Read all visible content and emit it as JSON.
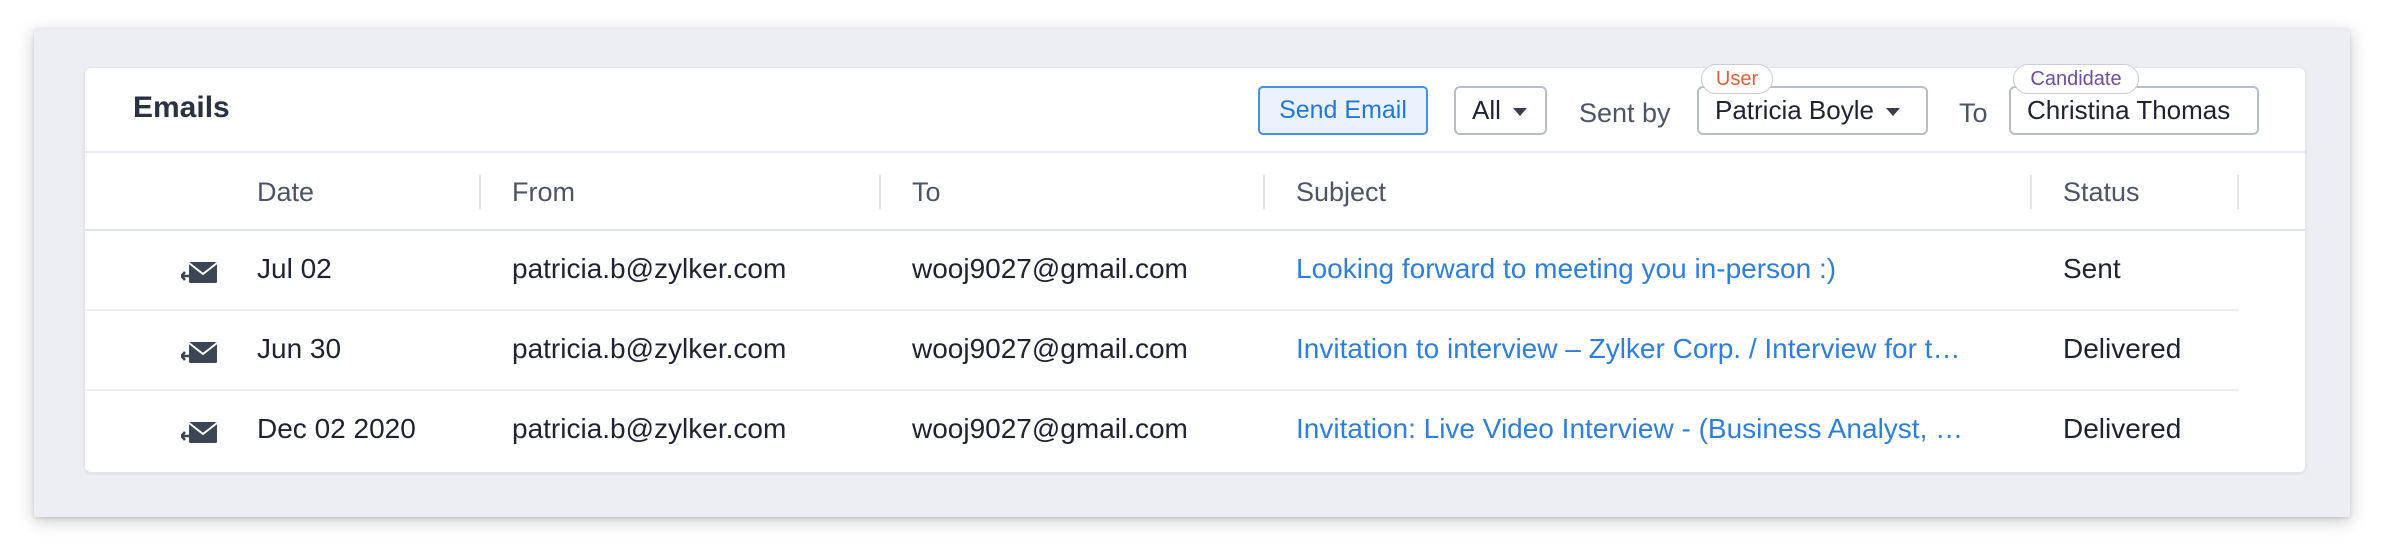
{
  "panel": {
    "title": "Emails",
    "send_email_label": "Send Email",
    "filter_all_value": "All",
    "sent_by_label": "Sent by",
    "sent_by_value": "Patricia Boyle",
    "user_badge": "User",
    "to_label": "To",
    "to_value": "Christina Thomas",
    "candidate_badge": "Candidate"
  },
  "table": {
    "columns": [
      "Date",
      "From",
      "To",
      "Subject",
      "Status"
    ],
    "rows": [
      {
        "icon": "sent-mail-icon",
        "date": "Jul 02",
        "from": "patricia.b@zylker.com",
        "to": "wooj9027@gmail.com",
        "subject": "Looking forward to meeting you in-person :)",
        "status": "Sent"
      },
      {
        "icon": "sent-mail-icon",
        "date": "Jun 30",
        "from": "patricia.b@zylker.com",
        "to": "wooj9027@gmail.com",
        "subject": "Invitation to interview – Zylker Corp. / Interview for t…",
        "status": "Delivered"
      },
      {
        "icon": "sent-mail-icon",
        "date": "Dec 02 2020",
        "from": "patricia.b@zylker.com",
        "to": "wooj9027@gmail.com",
        "subject": "Invitation: Live Video Interview - (Business Analyst, …",
        "status": "Delivered"
      }
    ]
  },
  "colors": {
    "accent": "#2f7fd9",
    "user_badge": "#d9603b",
    "candidate_badge": "#6b4fa0"
  }
}
